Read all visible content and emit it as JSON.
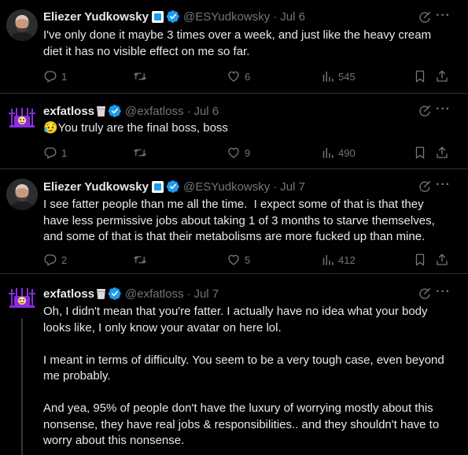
{
  "tweets": [
    {
      "name": "Eliezer Yudkowsky",
      "handle": "@ESYudkowsky",
      "date": "Jul 6",
      "text": "I've only done it maybe 3 times over a week, and just like the heavy cream diet it has no visible effect on me so far.",
      "replies": "1",
      "retweets": "",
      "likes": "6",
      "views": "545"
    },
    {
      "name": "exfatloss",
      "handle": "@exfatloss",
      "date": "Jul 6",
      "text": "😥You truly are the final boss, boss",
      "replies": "1",
      "retweets": "",
      "likes": "9",
      "views": "490"
    },
    {
      "name": "Eliezer Yudkowsky",
      "handle": "@ESYudkowsky",
      "date": "Jul 7",
      "text": "I see fatter people than me all the time.  I expect some of that is that they have less permissive jobs about taking 1 of 3 months to starve themselves, and some of that is that their metabolisms are more fucked up than mine.",
      "replies": "2",
      "retweets": "",
      "likes": "5",
      "views": "412"
    },
    {
      "name": "exfatloss",
      "handle": "@exfatloss",
      "date": "Jul 7",
      "text": "Oh, I didn't mean that you're fatter. I actually have no idea what your body looks like, I only know your avatar on here lol.\n\nI meant in terms of difficulty. You seem to be a very tough case, even beyond me probably.\n\nAnd yea, 95% of people don't have the luxury of worrying mostly about this nonsense, they have real jobs & responsibilities.. and they shouldn't have to worry about this nonsense."
    }
  ],
  "sep": "·",
  "more": "···",
  "colors": {
    "bg": "#000000",
    "text": "#e7e9ea",
    "muted": "#71767b",
    "verified": "#1d9bf0",
    "avatar_ex": "#8a2be2"
  }
}
